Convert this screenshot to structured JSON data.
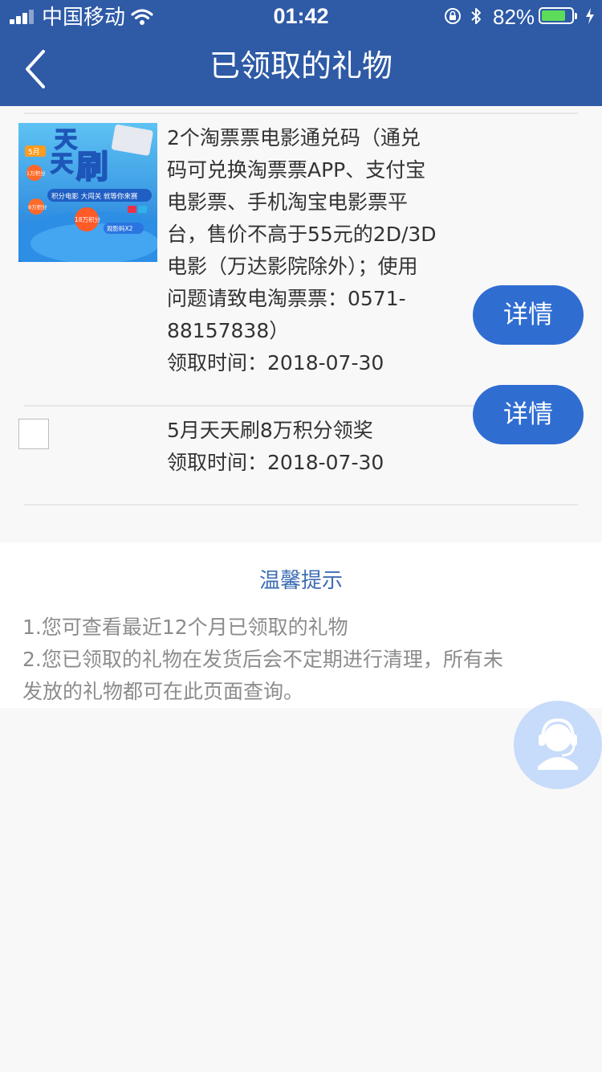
{
  "status_bar": {
    "carrier": "中国移动",
    "time": "01:42",
    "battery_percent": "82%",
    "battery_level": 0.82,
    "icons": [
      "signal-icon",
      "wifi-icon",
      "orientation-lock-icon",
      "bluetooth-icon",
      "battery-icon",
      "charging-icon"
    ]
  },
  "nav": {
    "title": "已领取的礼物",
    "back_icon": "chevron-left-icon"
  },
  "gifts": [
    {
      "thumb": {
        "month": "5月",
        "title_chars": [
          "天",
          "天",
          "刷"
        ],
        "ribbon": "积分电影 大闯关 就等你来赛",
        "badges": [
          "1万积分",
          "8万积分",
          "18万积分"
        ],
        "ticket_label": "观影码X2"
      },
      "description_lines": [
        "2个淘票票电影通兑码（通兑",
        "码可兑换淘票票APP、支付宝",
        "电影票、手机淘宝电影票平",
        "台，售价不高于55元的2D/3D",
        "电影（万达影院除外）；使用",
        "问题请致电淘票票：0571-",
        "88157838）"
      ],
      "time": "领取时间：2018-07-30",
      "detail_label": "详情"
    },
    {
      "description_lines": [
        "5月天天刷8万积分领奖"
      ],
      "time": "领取时间：2018-07-30",
      "detail_label": "详情"
    }
  ],
  "tips": {
    "title": "温馨提示",
    "lines": [
      "1.您可查看最近12个月已领取的礼物",
      "2.您已领取的礼物在发货后会不定期进行清理，所有未",
      "发放的礼物都可在此页面查询。"
    ]
  },
  "service_button": {
    "icon": "customer-service-icon"
  },
  "colors": {
    "brand_blue": "#2e5aa6",
    "button_blue": "#2f6dd1",
    "tips_title": "#3d6db4",
    "tips_text": "#8c8c8c",
    "battery_green": "#5ddc5a"
  }
}
